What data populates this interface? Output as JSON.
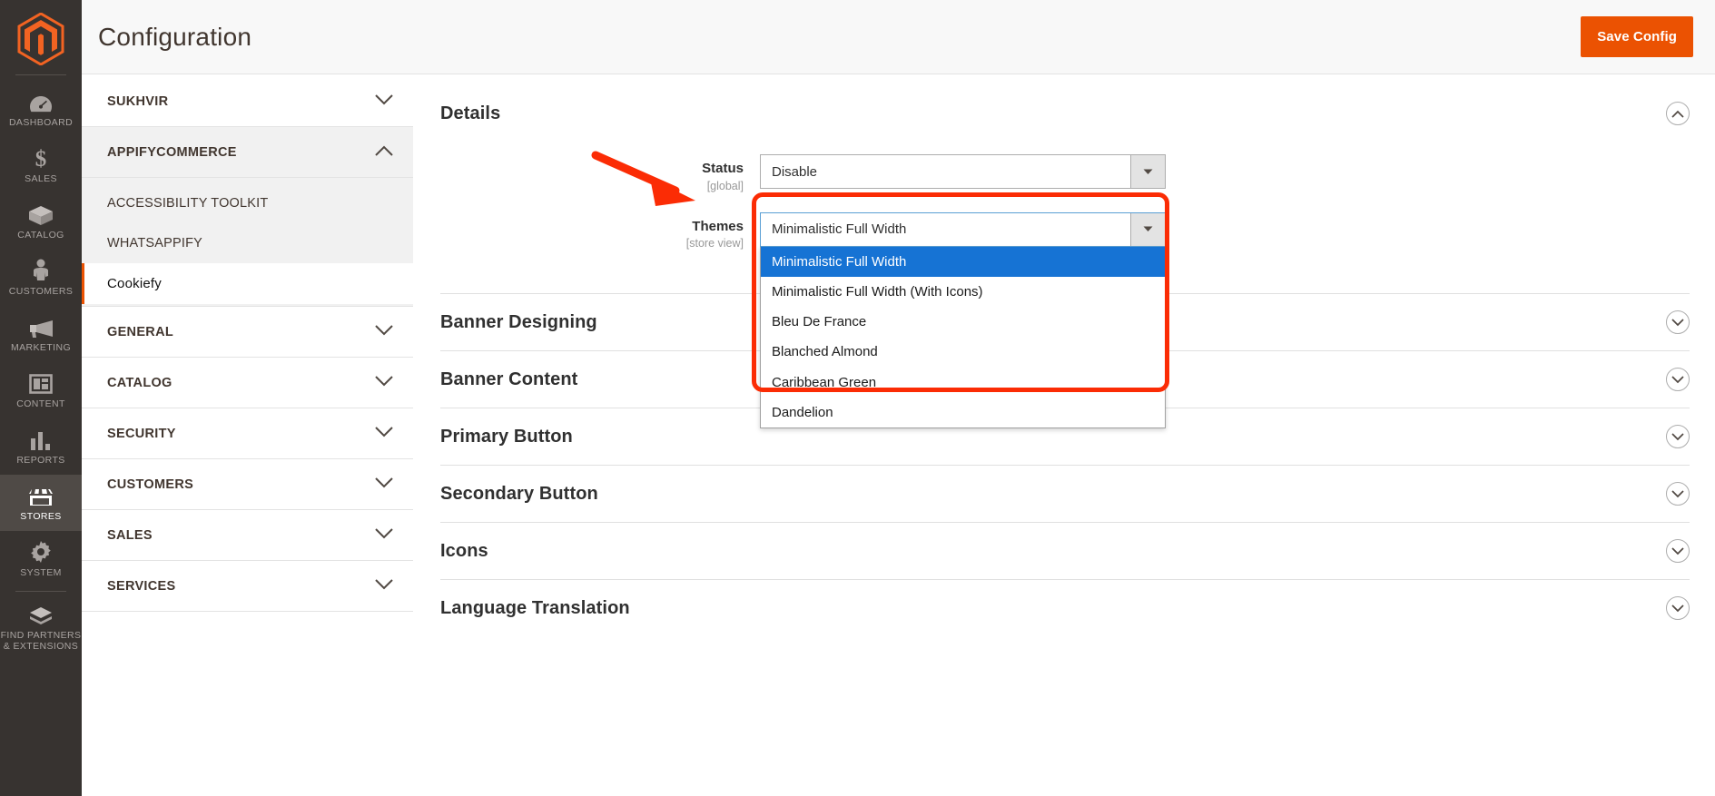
{
  "admin_nav": {
    "logo": "magento-logo",
    "items": [
      {
        "label": "DASHBOARD",
        "icon": "dashboard-icon",
        "active": false
      },
      {
        "label": "SALES",
        "icon": "dollar-icon",
        "active": false
      },
      {
        "label": "CATALOG",
        "icon": "box-icon",
        "active": false
      },
      {
        "label": "CUSTOMERS",
        "icon": "person-icon",
        "active": false
      },
      {
        "label": "MARKETING",
        "icon": "megaphone-icon",
        "active": false
      },
      {
        "label": "CONTENT",
        "icon": "layout-icon",
        "active": false
      },
      {
        "label": "REPORTS",
        "icon": "bar-chart-icon",
        "active": false
      },
      {
        "label": "STORES",
        "icon": "storefront-icon",
        "active": true
      },
      {
        "label": "SYSTEM",
        "icon": "gear-icon",
        "active": false
      },
      {
        "label": "FIND PARTNERS\n& EXTENSIONS",
        "icon": "extension-icon",
        "active": false
      }
    ]
  },
  "header": {
    "title": "Configuration",
    "save_label": "Save Config"
  },
  "tree": {
    "sections": [
      {
        "label": "SUKHVIR",
        "state": "collapsed",
        "icon": "chevron-down-icon"
      },
      {
        "label": "APPIFYCOMMERCE",
        "state": "expanded",
        "icon": "chevron-up-icon"
      }
    ],
    "appify_children": [
      {
        "label": "ACCESSIBILITY TOOLKIT",
        "current": false
      },
      {
        "label": "WHATSAPPIFY",
        "current": false
      },
      {
        "label": "Cookiefy",
        "current": true
      }
    ],
    "more_sections": [
      {
        "label": "GENERAL",
        "icon": "chevron-down-icon"
      },
      {
        "label": "CATALOG",
        "icon": "chevron-down-icon"
      },
      {
        "label": "SECURITY",
        "icon": "chevron-down-icon"
      },
      {
        "label": "CUSTOMERS",
        "icon": "chevron-down-icon"
      },
      {
        "label": "SALES",
        "icon": "chevron-down-icon"
      },
      {
        "label": "SERVICES",
        "icon": "chevron-down-icon"
      }
    ]
  },
  "main": {
    "details": {
      "title": "Details",
      "toggle_icon": "collapse-circle-icon",
      "fields": {
        "status": {
          "label": "Status",
          "scope": "[global]",
          "value": "Disable",
          "arrow_icon": "select-arrow-icon"
        },
        "themes": {
          "label": "Themes",
          "scope": "[store view]",
          "value": "Minimalistic Full Width",
          "arrow_icon": "select-arrow-icon",
          "options": [
            {
              "label": "Minimalistic Full Width",
              "selected": true
            },
            {
              "label": "Minimalistic Full Width (With Icons)",
              "selected": false
            },
            {
              "label": "Bleu De France",
              "selected": false
            },
            {
              "label": "Blanched Almond",
              "selected": false
            },
            {
              "label": "Caribbean Green",
              "selected": false
            },
            {
              "label": "Dandelion",
              "selected": false
            }
          ]
        }
      }
    },
    "sections": [
      {
        "title": "Banner Designing",
        "toggle_icon": "expand-circle-icon"
      },
      {
        "title": "Banner Content",
        "toggle_icon": "expand-circle-icon"
      },
      {
        "title": "Primary Button",
        "toggle_icon": "expand-circle-icon"
      },
      {
        "title": "Secondary Button",
        "toggle_icon": "expand-circle-icon"
      },
      {
        "title": "Icons",
        "toggle_icon": "expand-circle-icon"
      },
      {
        "title": "Language Translation",
        "toggle_icon": "expand-circle-icon"
      }
    ]
  },
  "annotations": {
    "arrow": "red-arrow-annotation",
    "highlight": "red-rounded-rectangle-annotation"
  },
  "colors": {
    "brand_orange": "#eb5202",
    "annotation_red": "#fb2c05",
    "option_selected_blue": "#1673d4",
    "nav_background": "#373330"
  }
}
